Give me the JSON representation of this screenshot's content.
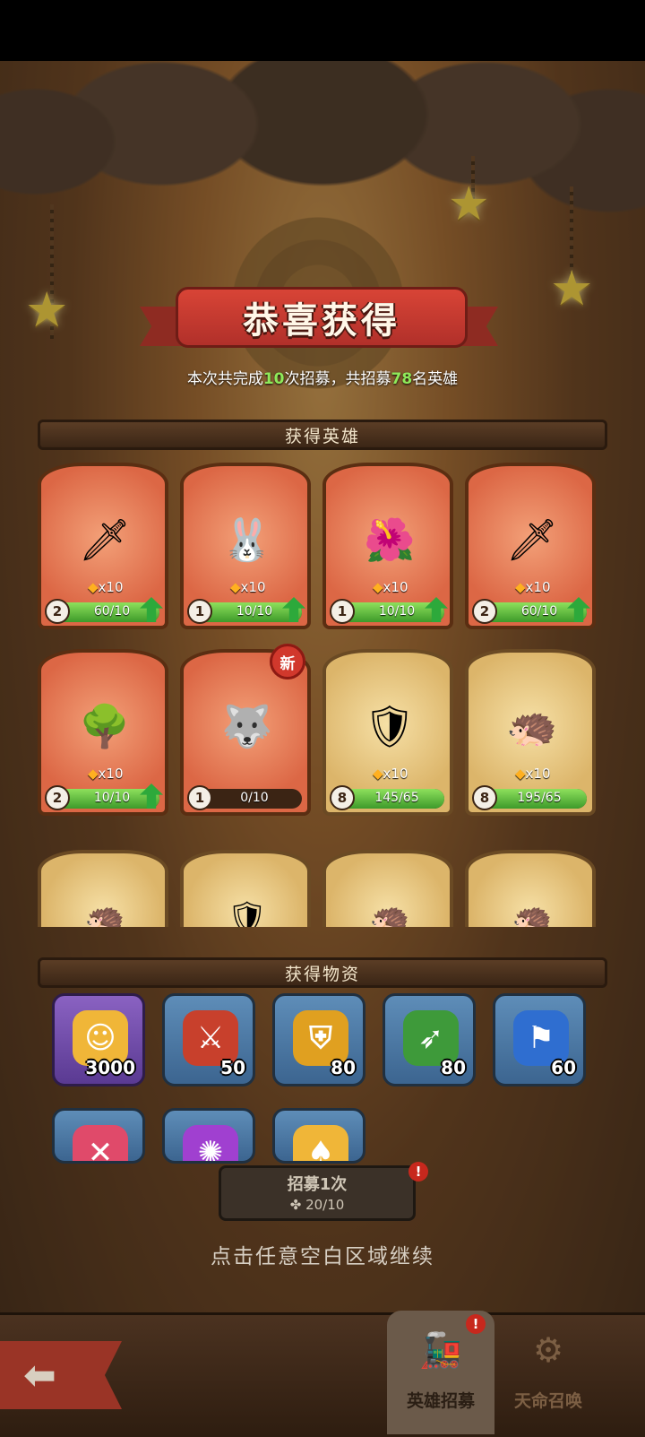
{
  "header": {
    "title": "恭喜获得",
    "summary_prefix": "本次共完成",
    "recruit_times": "10",
    "summary_mid": "次招募，共招募",
    "hero_total": "78",
    "summary_suffix": "名英雄"
  },
  "heroes_section": {
    "title": "获得英雄",
    "cards": [
      {
        "art": "archer-hero",
        "qty": "x10",
        "stars": "2",
        "progress_text": "60/10",
        "progress": 1.0,
        "upgrade": true,
        "rarity": "red"
      },
      {
        "art": "bunny-hero",
        "qty": "x10",
        "stars": "1",
        "progress_text": "10/10",
        "progress": 1.0,
        "upgrade": true,
        "rarity": "red"
      },
      {
        "art": "flower-hero",
        "qty": "x10",
        "stars": "1",
        "progress_text": "10/10",
        "progress": 1.0,
        "upgrade": true,
        "rarity": "red"
      },
      {
        "art": "archer-hero",
        "qty": "x10",
        "stars": "2",
        "progress_text": "60/10",
        "progress": 1.0,
        "upgrade": true,
        "rarity": "red"
      },
      {
        "art": "treant-hero",
        "qty": "x10",
        "stars": "2",
        "progress_text": "10/10",
        "progress": 1.0,
        "upgrade": true,
        "rarity": "red"
      },
      {
        "art": "wolf-hero",
        "qty": "",
        "stars": "1",
        "progress_text": "0/10",
        "progress": 0.0,
        "upgrade": false,
        "rarity": "red",
        "badge": "新"
      },
      {
        "art": "knight-hero",
        "qty": "x10",
        "stars": "8",
        "progress_text": "145/65",
        "progress": 1.0,
        "upgrade": false,
        "rarity": "gold"
      },
      {
        "art": "spiky-hero",
        "qty": "x10",
        "stars": "8",
        "progress_text": "195/65",
        "progress": 1.0,
        "upgrade": false,
        "rarity": "gold"
      }
    ]
  },
  "items_section": {
    "title": "获得物资",
    "items": [
      {
        "icon": "coin-smile-icon",
        "count": "3000",
        "tile": "purple"
      },
      {
        "icon": "sword-rune-icon",
        "count": "50",
        "tile": "blue"
      },
      {
        "icon": "shield-rune-icon",
        "count": "80",
        "tile": "blue"
      },
      {
        "icon": "bow-rune-icon",
        "count": "80",
        "tile": "blue"
      },
      {
        "icon": "hat-rune-icon",
        "count": "60",
        "tile": "blue"
      },
      {
        "icon": "cross-rune-icon",
        "count": "",
        "tile": "blue"
      },
      {
        "icon": "swirl-rune-icon",
        "count": "",
        "tile": "blue"
      },
      {
        "icon": "spade-coin-icon",
        "count": "",
        "tile": "blue"
      }
    ]
  },
  "recruit_button": {
    "label": "招募1次",
    "cost": "20/10"
  },
  "continue_hint": "点击任意空白区域继续",
  "bottom_nav": {
    "tab_hero_recruit": "英雄招募",
    "tab_fate_summon": "天命召唤"
  },
  "colors": {
    "banner_red": "#c23a2f",
    "highlight_green": "#8eea5a",
    "progress_green": "#3d9a2a"
  }
}
